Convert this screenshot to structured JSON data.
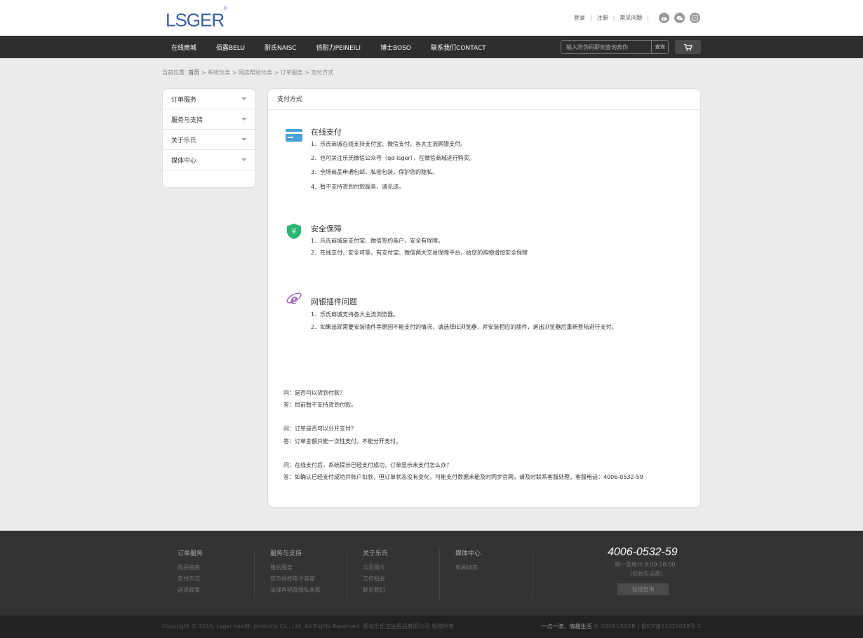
{
  "header": {
    "logo": "LSGER",
    "logo_mark": "®",
    "links": [
      "登录",
      "注册",
      "常见问题"
    ],
    "social_icons": [
      "weibo-icon",
      "wechat-icon",
      "taobao-icon"
    ]
  },
  "nav": {
    "items": [
      "在线商城",
      "佰露BELU",
      "耐氏NAISC",
      "倍耐力PEINEILI",
      "博士BOSO",
      "联系我们CONTACT"
    ],
    "search_placeholder": "输入防伪码即刻查询真伪",
    "search_button": "查询"
  },
  "breadcrumb": {
    "prefix": "当前位置:",
    "items": [
      "首页",
      "系统分类",
      "网店帮助分类",
      "订单服务",
      "支付方式"
    ]
  },
  "sidebar": {
    "items": [
      "订单服务",
      "服务与支持",
      "关于乐氏",
      "媒体中心"
    ]
  },
  "main": {
    "title": "支付方式",
    "online": {
      "title": "在线支付",
      "lines": [
        "1．乐氏商城在线支持支付宝、微信支付、各大主流网银支付。",
        "2．也可关注乐氏微信公众号（qd-lsger），在微信商城进行购买。",
        "3．全场商品申通包邮，私密包装，保护您的隐私。",
        "4．暂不支持货到付款服务，请见谅。"
      ]
    },
    "security": {
      "title": "安全保障",
      "lines": [
        "1．乐氏商城是支付宝、微信签约商户，安全有保障。",
        "2．在线支付，安全可靠，有支付宝、微信两大交易保障平台，给您的购物增加安全保障"
      ]
    },
    "plugin": {
      "title": "网银插件问题",
      "lines": [
        "1．乐氏商城支持各大主流浏览器。",
        "2．如果出现需要安装插件等原因不能支付的情况，请选择IE浏览器，并安装相应的插件，退出浏览器后重新登陆进行支付。"
      ]
    },
    "faq": [
      {
        "q": "问：是否可以货到付款？",
        "a": "答：目前暂不支持货到付款。"
      },
      {
        "q": "问：订单是否可以分开支付？",
        "a": "答：订单金额只能一次性支付，不能分开支付。"
      },
      {
        "q": "问：在线支付后，系统提示已经支付成功，订单显示未支付怎么办？",
        "a": "答：如确认已经支付成功并账户扣款，但订单状态没有变化，可能支付数据未能及时同步官网，请及时联系客服处理，客服电话：4006-0532-59"
      }
    ]
  },
  "footer": {
    "cols": [
      {
        "title": "订单服务",
        "links": [
          "购买指南",
          "支付方式",
          "送货政策"
        ]
      },
      {
        "title": "服务与支持",
        "links": [
          "售后服务",
          "官方授权电子商家",
          "法律声明及隐私条款"
        ]
      },
      {
        "title": "关于乐氏",
        "links": [
          "公司简介",
          "工作机会",
          "联系我们"
        ]
      },
      {
        "title": "媒体中心",
        "links": [
          "新闻动态"
        ]
      }
    ],
    "phone": "4006-0532-59",
    "hours": "周一至周六 9:00-18:00",
    "hours_note": "（仅收市话费）",
    "online_button": "在线咨询",
    "copyright": "Copyright © 2016, Lsger health products Co., Ltd. All Rights Reserved. 青岛乐氏卫生用品有限公司 版权所有",
    "slogan": "一点一滴，情趣生活",
    "icp": "© 2016 LSGER | 鲁ICP备11022018号-1"
  },
  "colors": {
    "logo": "#3a5aa8",
    "nav_bg": "#2e2e2e",
    "card_icon": "#4aa0db",
    "shield_icon": "#2bb673",
    "ie_icon": "#9b5fbf"
  }
}
